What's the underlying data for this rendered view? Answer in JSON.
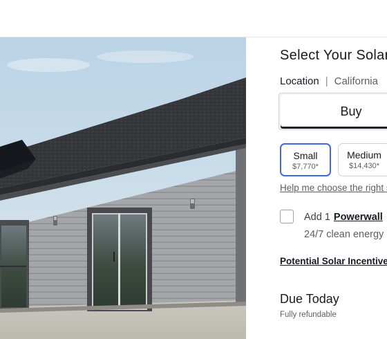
{
  "configurator": {
    "title": "Select Your Solar",
    "location": {
      "label": "Location",
      "separator": "|",
      "value": "California"
    },
    "purchase_tabs": [
      {
        "label": "Buy",
        "selected": true
      }
    ],
    "sizes": [
      {
        "name": "Small",
        "price": "$7,770*",
        "selected": true
      },
      {
        "name": "Medium",
        "price": "$14,430*",
        "selected": false
      }
    ],
    "help_link": "Help me choose the right size",
    "addon": {
      "checked": false,
      "prefix": "Add 1",
      "product": "Powerwall",
      "description": "24/7 clean energy"
    },
    "incentives_link": "Potential Solar Incentives",
    "due_today": {
      "title": "Due Today",
      "subtitle": "Fully refundable"
    },
    "colors": {
      "accent": "#3e6ae1",
      "text": "#171a20",
      "muted": "#5c5e62",
      "border": "#d0d1d2"
    }
  }
}
